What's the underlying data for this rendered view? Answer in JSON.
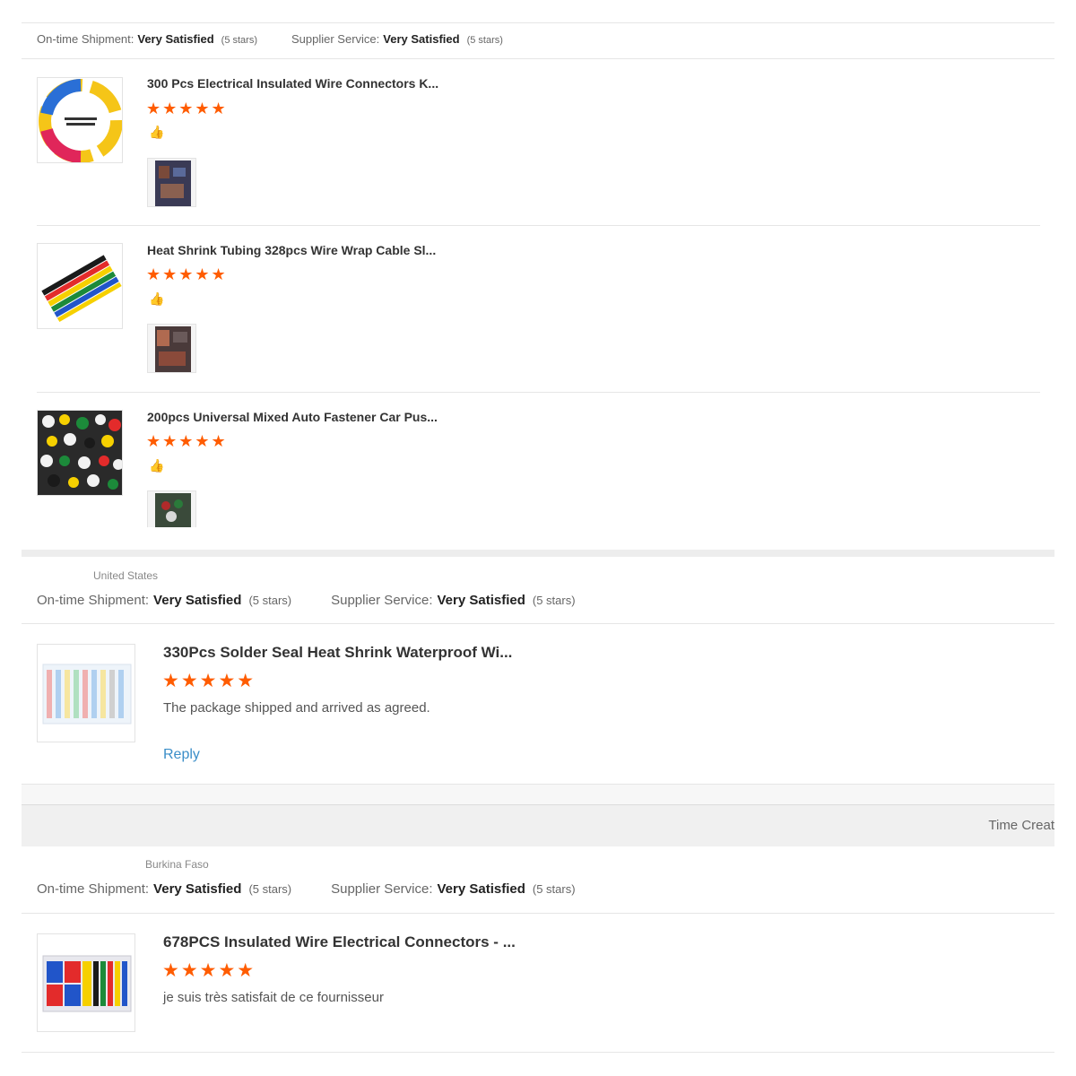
{
  "section1": {
    "ratings": {
      "shipment_label": "On-time Shipment:",
      "shipment_value": "Very Satisfied",
      "shipment_stars": "(5 stars)",
      "service_label": "Supplier Service:",
      "service_value": "Very Satisfied",
      "service_stars": "(5 stars)"
    },
    "items": [
      {
        "title": "300 Pcs Electrical Insulated Wire Connectors K...",
        "stars": "★★★★★",
        "rating": 5,
        "reaction": "👍"
      },
      {
        "title": "Heat Shrink Tubing 328pcs Wire Wrap Cable Sl...",
        "stars": "★★★★★",
        "rating": 5,
        "reaction": "👍"
      },
      {
        "title": "200pcs Universal Mixed Auto Fastener Car Pus...",
        "stars": "★★★★★",
        "rating": 5,
        "reaction": "👍"
      }
    ]
  },
  "section2": {
    "country": "United States",
    "ratings": {
      "shipment_label": "On-time Shipment:",
      "shipment_value": "Very Satisfied",
      "shipment_stars": "(5 stars)",
      "service_label": "Supplier Service:",
      "service_value": "Very Satisfied",
      "service_stars": "(5 stars)"
    },
    "item": {
      "title": "330Pcs Solder Seal Heat Shrink Waterproof Wi...",
      "stars": "★★★★★",
      "rating": 5,
      "comment": "The package shipped and arrived as agreed.",
      "reply_label": "Reply"
    }
  },
  "header_bar": {
    "time_label": "Time Creat"
  },
  "section3": {
    "country": "Burkina Faso",
    "ratings": {
      "shipment_label": "On-time Shipment:",
      "shipment_value": "Very Satisfied",
      "shipment_stars": "(5 stars)",
      "service_label": "Supplier Service:",
      "service_value": "Very Satisfied",
      "service_stars": "(5 stars)"
    },
    "item": {
      "title": "678PCS Insulated Wire Electrical Connectors - ...",
      "stars": "★★★★★",
      "rating": 5,
      "comment": "je suis très satisfait de ce fournisseur"
    }
  },
  "colors": {
    "star": "#ff5c00",
    "link": "#3b8ec8",
    "divider": "#e6e6e6",
    "bar": "#f0f0f0"
  }
}
